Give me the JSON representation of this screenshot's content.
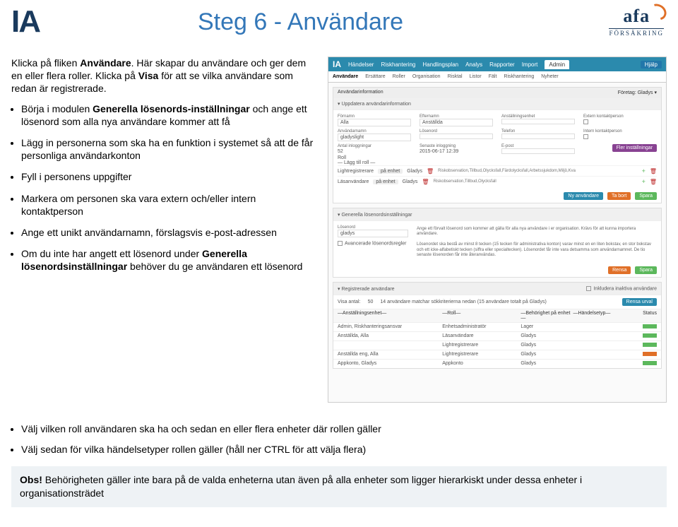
{
  "header": {
    "logo_left": "IA",
    "title": "Steg 6 - Användare",
    "logo_right_main": "afa",
    "logo_right_sub": "FÖRSÄKRING"
  },
  "intro": {
    "line1_a": "Klicka på fliken ",
    "line1_b": "Användare",
    "line1_c": ". Här skapar du användare och ger dem en eller flera roller. Klicka på ",
    "line1_d": "Visa",
    "line1_e": " för att se vilka användare som redan är registrerade."
  },
  "bullets": [
    {
      "a": "Börja i modulen ",
      "b": "Generella lösenords-inställningar",
      "c": " och ange ett lösenord som alla nya användare kommer att få"
    },
    {
      "a": "Lägg in personerna som ska ha en funktion i systemet så att de får personliga användarkonton"
    },
    {
      "a": "Fyll i personens uppgifter"
    },
    {
      "a": "Markera om personen ska vara extern och/eller intern kontaktperson"
    },
    {
      "a": "Ange ett unikt användarnamn, förslagsvis e-post-adressen"
    },
    {
      "a": "Om du inte har angett ett lösenord under ",
      "b": "Generella lösenordsinställningar",
      "c": " behöver du ge användaren ett lösenord"
    }
  ],
  "lower_bullets": [
    "Välj vilken roll användaren ska ha och sedan en eller flera enheter där rollen gäller",
    "Välj sedan för vilka händelsetyper rollen gäller (håll ner CTRL för att välja flera)"
  ],
  "obs": {
    "bold": "Obs!",
    "text": " Behörigheten gäller inte bara på de valda enheterna utan även på alla enheter som ligger hierarkiskt under dessa enheter i organisationsträdet"
  },
  "shot": {
    "topnav": [
      "Händelser",
      "Riskhantering",
      "Handlingsplan",
      "Analys",
      "Rapporter",
      "Import"
    ],
    "admin": "Admin",
    "help": "Hjälp",
    "subnav": [
      "Användare",
      "Ersättare",
      "Roller",
      "Organisation",
      "Risktal",
      "Listor",
      "Fält",
      "Riskhantering",
      "Nyheter"
    ],
    "panel_title": "Användarinformation",
    "company_label": "Företag:",
    "company": "Gladys",
    "section1": "Uppdatera användarinformation",
    "f_fornamn_lbl": "Förnamn",
    "f_fornamn": "Alla",
    "f_efternamn_lbl": "Efternamn",
    "f_efternamn": "Anställda",
    "f_enhet_lbl": "Anställningsenhet",
    "f_extern_lbl": "Extern kontaktperson",
    "f_anvnamn_lbl": "Användarnamn",
    "f_anvnamn": "gladyslight",
    "f_losen_lbl": "Lösenord",
    "f_telefon_lbl": "Telefon",
    "f_intern_lbl": "Intern kontaktperson",
    "f_antal_lbl": "Antal inloggningar",
    "f_antal": "52",
    "f_senaste_lbl": "Senaste inloggning",
    "f_senaste": "2015-06-17 12:39",
    "f_epost_lbl": "E-post",
    "btn_fler": "Fler inställningar",
    "roll_lbl": "Roll",
    "roll_add": "— Lägg till roll —",
    "role1": "Lightregistrerare",
    "unit": "på enhet",
    "who": "Gladys",
    "role1_tags": "Riskobservation,Tillbud,Olycksfall,Färdolycksfall,Arbetssjukdom,Miljö,Kva",
    "role2": "Läsanvändare",
    "role2_tags": "Riskobservation,Tillbud,Olycksfall",
    "btn_ny": "Ny användare",
    "btn_tabort": "Ta bort",
    "btn_spara": "Spara",
    "section2": "Generella lösenordsinställningar",
    "gl_losen_lbl": "Lösenord",
    "gl_losen": "gladys",
    "gl_para1": "Ange ett förvalt lösenord som kommer att gälla för alla nya användare i er organisation. Krävs för att kunna importera användare.",
    "gl_adv_lbl": "Avancerade lösenordsregler",
    "gl_para2": "Lösenordet ska bestå av minst 8 tecken (15 tecken för administrativa konton) varav minst en en liten bokstav, en stor bokstav och ett icke-alfabetiskt tecken (siffra eller specialtecken). Lösenordet får inte vara detsamma som användarnamnet. De tio senaste lösenorden får inte återanvändas.",
    "btn_rensa": "Rensa",
    "section3": "Registrerade användare",
    "inkl_lbl": "Inkludera inaktiva användare",
    "visa_lbl": "Visa antal:",
    "visa_val": "50",
    "match_text": "14 användare matchar sökkriterierna nedan (15 användare totalt på Gladys)",
    "btn_rensaurval": "Rensa urval",
    "filter1": "—Anställningsenhet—",
    "filter2": "—Roll—",
    "filter3": "—Behörighet på enhet—",
    "filter4": "—Händelsetyp—",
    "filter5": "Status",
    "rows": [
      {
        "c1": "Admin, Riskhanteringsansvar",
        "c2": "Enhetsadministratör",
        "c3": "Lager"
      },
      {
        "c1": "Anställda, Alla",
        "c2": "Läsanvändare",
        "c3": "Gladys"
      },
      {
        "c1": "",
        "c2": "Lightregistrerare",
        "c3": "Gladys"
      },
      {
        "c1": "Anställda eng, Alla",
        "c2": "Lightregistrerare",
        "c3": "Gladys"
      },
      {
        "c1": "Appkonto, Gladys",
        "c2": "Appkonto",
        "c3": "Gladys"
      }
    ]
  }
}
